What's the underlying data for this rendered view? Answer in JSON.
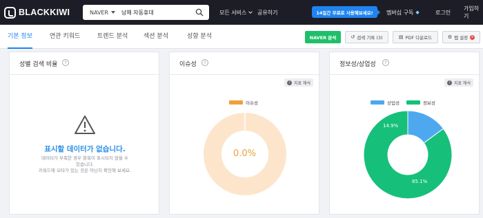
{
  "brand": {
    "name": "BLACKKIWI"
  },
  "search": {
    "engine": "NAVER",
    "query": "남해 자동휴대"
  },
  "topnav": {
    "services": "모든 서비스",
    "share": "공유하기",
    "promo": "14일간 무료로 사용해보세요!",
    "subscribe": "멤버십 구독",
    "login": "로그인",
    "signup": "가입하기"
  },
  "tabs": [
    "기본 정보",
    "연관 키워드",
    "트렌드 분석",
    "섹션 분석",
    "성향 분석"
  ],
  "active_tab": 0,
  "toolbar": {
    "naver": "NAVER 분석",
    "history": "검색 기록 (3)",
    "pdf": "PDF 다운로드",
    "settings": "맵 설정"
  },
  "cards": {
    "gender": {
      "title": "성별 검색 비율",
      "empty_title": "표시할 데이터가 없습니다.",
      "empty_desc_1": "데이터가 부족한 경우 항목이 표시되지 않을 수",
      "empty_desc_2": "있습니다.",
      "empty_desc_3": "키워드에 오타가 있는 것은 아닌지 확인해 보세요."
    },
    "issue": {
      "title": "이슈성",
      "index_btn": "지표 해석",
      "legend": "이슈성",
      "value_label": "0.0%",
      "color": "#f0a03c",
      "ring_color": "#fde5cc"
    },
    "info": {
      "title": "정보성/상업성",
      "index_btn": "지표 해석",
      "legend_commercial": "상업성",
      "legend_info": "정보성",
      "commercial_label": "14.9%",
      "info_label": "85.1%",
      "commercial_color": "#4ea8f0",
      "info_color": "#16c07a"
    }
  },
  "chart_data": [
    {
      "type": "pie",
      "title": "이슈성",
      "categories": [
        "이슈성"
      ],
      "values": [
        0.0
      ],
      "colors": [
        "#f0a03c"
      ]
    },
    {
      "type": "pie",
      "title": "정보성/상업성",
      "categories": [
        "상업성",
        "정보성"
      ],
      "values": [
        14.9,
        85.1
      ],
      "colors": [
        "#4ea8f0",
        "#16c07a"
      ]
    }
  ]
}
